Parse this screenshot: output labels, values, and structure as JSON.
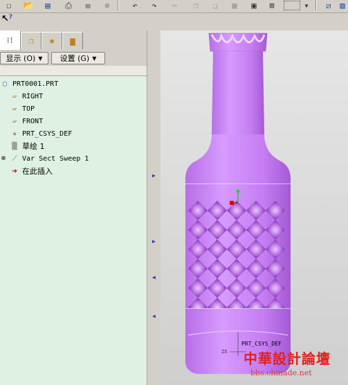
{
  "toolbar": {
    "icons": [
      "new-icon",
      "open-icon",
      "save-icon",
      "print-icon",
      "email-icon",
      "link-icon",
      "undo-icon",
      "redo-icon",
      "cut-icon",
      "copy-icon",
      "paste-icon",
      "paste-special-icon",
      "regenerate-icon",
      "find-icon",
      "select-box-icon",
      "dropdown-arrow-icon",
      "sketch-icon"
    ]
  },
  "help": {
    "label": "?"
  },
  "model_tree": {
    "tabs": [
      "model-tree",
      "layers",
      "features",
      "tools"
    ],
    "show_label": "显示 (O)",
    "settings_label": "设置 (G)",
    "items": [
      {
        "label": "PRT0001.PRT",
        "icon": "part-icon"
      },
      {
        "label": "RIGHT",
        "icon": "datum-plane-icon"
      },
      {
        "label": "TOP",
        "icon": "datum-plane-icon"
      },
      {
        "label": "FRONT",
        "icon": "datum-plane-icon"
      },
      {
        "label": "PRT_CSYS_DEF",
        "icon": "csys-icon"
      },
      {
        "label": "草绘 1",
        "icon": "sketch-icon"
      },
      {
        "label": "Var Sect Sweep 1",
        "icon": "sweep-icon"
      },
      {
        "label": "在此插入",
        "icon": "insert-here-arrow-icon"
      }
    ]
  },
  "viewport": {
    "csys_label": "PRT_CSYS_DEF",
    "accent_color": "#c77df0"
  },
  "watermark": {
    "text": "中華設計論壇",
    "url": "bbs.chinade.net"
  }
}
